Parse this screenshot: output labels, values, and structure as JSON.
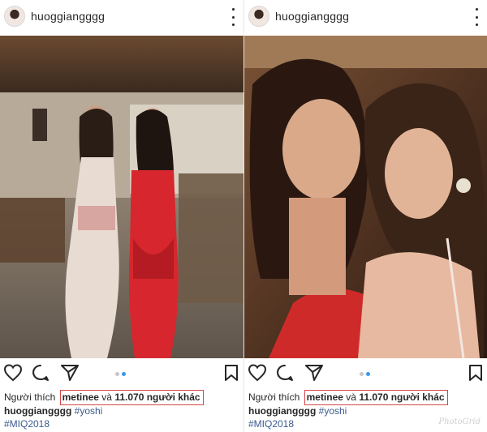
{
  "posts": [
    {
      "username": "huoggiangggg",
      "photo_alt": "photo",
      "likes_prefix": "Người thích",
      "liked_user": "metinee",
      "likes_joiner": "và",
      "likes_count": "11.070 người khác",
      "caption_user": "huoggiangggg",
      "caption_tag": "#yoshi",
      "hashtag": "#MIQ2018",
      "carousel_total": 2,
      "carousel_index": 2
    },
    {
      "username": "huoggiangggg",
      "photo_alt": "photo",
      "likes_prefix": "Người thích",
      "liked_user": "metinee",
      "likes_joiner": "và",
      "likes_count": "11.070 người khác",
      "caption_user": "huoggiangggg",
      "caption_tag": "#yoshi",
      "hashtag": "#MIQ2018",
      "carousel_total": 2,
      "carousel_index": 2
    }
  ],
  "watermark": "PhotoGrid",
  "icons": [
    "heart-icon",
    "comment-icon",
    "share-icon",
    "bookmark-icon",
    "more-icon"
  ],
  "colors": {
    "highlight_box": "#d64545",
    "active_dot": "#3897f0",
    "hashtag": "#3a5a8c"
  }
}
